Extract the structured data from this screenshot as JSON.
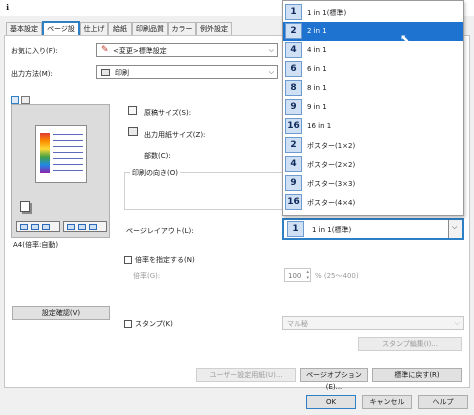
{
  "title": "ℹ",
  "tabs": [
    {
      "label": "基本設定"
    },
    {
      "label": "ページ設定"
    },
    {
      "label": "仕上げ"
    },
    {
      "label": "給紙"
    },
    {
      "label": "印刷品質"
    },
    {
      "label": "カラー"
    },
    {
      "label": "例外設定"
    }
  ],
  "favorites": {
    "label": "お気に入り(F):",
    "value": "<変更>標準設定"
  },
  "output_method": {
    "label": "出力方法(M):",
    "value": "印刷"
  },
  "preview": {
    "caption": "A4(倍率:自動)"
  },
  "original_size": {
    "label": "原稿サイズ(S):"
  },
  "output_paper_size": {
    "label": "出力用紙サイズ(Z):"
  },
  "copies": {
    "label": "部数(C):"
  },
  "orientation": {
    "label": "印刷の向き(O)"
  },
  "page_layout": {
    "label": "ページレイアウト(L):",
    "num": "1",
    "value": "1 in 1(標準)"
  },
  "zoom": {
    "label": "倍率を指定する(N)",
    "sub_label": "倍率(G):",
    "value": "100",
    "range": "% (25〜400)"
  },
  "stamp": {
    "label": "スタンプ(K)",
    "value": "マル秘",
    "edit_button": "スタンプ編集(I)..."
  },
  "buttons": {
    "check_settings": "設定確認(V)",
    "user_paper": "ユーザー設定用紙(U)...",
    "page_options": "ページオプション(E)...",
    "restore_default": "標準に戻す(R)",
    "ok": "OK",
    "cancel": "キャンセル",
    "help": "ヘルプ"
  },
  "dropdown_items": [
    {
      "num": "1",
      "label": "1 in 1(標準)"
    },
    {
      "num": "2",
      "label": "2 in 1"
    },
    {
      "num": "4",
      "label": "4 in 1"
    },
    {
      "num": "6",
      "label": "6 in 1"
    },
    {
      "num": "8",
      "label": "8 in 1"
    },
    {
      "num": "9",
      "label": "9 in 1"
    },
    {
      "num": "16",
      "label": "16 in 1"
    },
    {
      "num": "2",
      "label": "ポスター(1×2)"
    },
    {
      "num": "4",
      "label": "ポスター(2×2)"
    },
    {
      "num": "9",
      "label": "ポスター(3×3)"
    },
    {
      "num": "16",
      "label": "ポスター(4×4)"
    }
  ],
  "colors": {
    "accent": "#2f7fc4",
    "selected_item": "#1e72d0"
  }
}
